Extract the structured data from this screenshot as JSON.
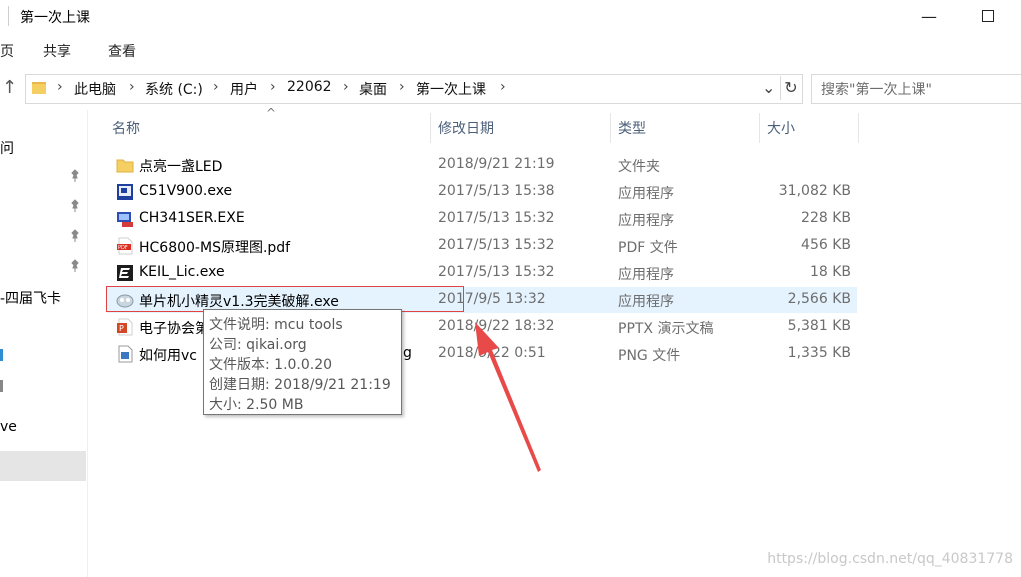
{
  "window": {
    "title": "第一次上课",
    "minimize_glyph": "—",
    "maximize_glyph": "☐"
  },
  "ribbon": {
    "tabs": [
      "页",
      "共享",
      "查看"
    ]
  },
  "address": {
    "back_glyph": "↑",
    "crumbs": [
      "此电脑",
      "系统 (C:)",
      "用户",
      "22062",
      "桌面",
      "第一次上课"
    ],
    "dropdown_glyph": "⌄",
    "refresh_glyph": "↻"
  },
  "search": {
    "text": "搜索\"第一次上课\""
  },
  "nav": {
    "items": [
      "问",
      "-四届飞卡",
      "ve"
    ]
  },
  "columns": {
    "name": "名称",
    "date": "修改日期",
    "type": "类型",
    "size": "大小",
    "sort_glyph": "^"
  },
  "files": [
    {
      "name": "点亮一盏LED",
      "date": "2018/9/21 21:19",
      "type": "文件夹",
      "size": "",
      "icon": "folder-icon"
    },
    {
      "name": "C51V900.exe",
      "date": "2017/5/13 15:38",
      "type": "应用程序",
      "size": "31,082 KB",
      "icon": "application-icon"
    },
    {
      "name": "CH341SER.EXE",
      "date": "2017/5/13 15:32",
      "type": "应用程序",
      "size": "228 KB",
      "icon": "installer-icon"
    },
    {
      "name": "HC6800-MS原理图.pdf",
      "date": "2017/5/13 15:32",
      "type": "PDF 文件",
      "size": "456 KB",
      "icon": "pdf-icon"
    },
    {
      "name": "KEIL_Lic.exe",
      "date": "2017/5/13 15:32",
      "type": "应用程序",
      "size": "18 KB",
      "icon": "keil-icon"
    },
    {
      "name": "单片机小精灵v1.3完美破解.exe",
      "date": "2017/9/5 13:32",
      "type": "应用程序",
      "size": "2,566 KB",
      "icon": "mcu-tool-icon"
    },
    {
      "name": "电子协会第",
      "date": "2018/9/22 18:32",
      "type": "PPTX 演示文稿",
      "size": "5,381 KB",
      "icon": "pptx-icon"
    },
    {
      "name": "如何用vc",
      "name_tail": "g",
      "date": "2018/9/22 0:51",
      "type": "PNG 文件",
      "size": "1,335 KB",
      "icon": "png-icon"
    }
  ],
  "selected_row": 5,
  "tooltip": {
    "lines": [
      "文件说明: mcu tools",
      "公司: qikai.org",
      "文件版本: 1.0.0.20",
      "创建日期: 2018/9/21 21:19",
      "大小: 2.50 MB"
    ]
  },
  "watermark": "https://blog.csdn.net/qq_40831778",
  "colors": {
    "selected_row": "#e5f3ff",
    "annotation": "#e84a4a",
    "header_text": "#4c607a"
  }
}
